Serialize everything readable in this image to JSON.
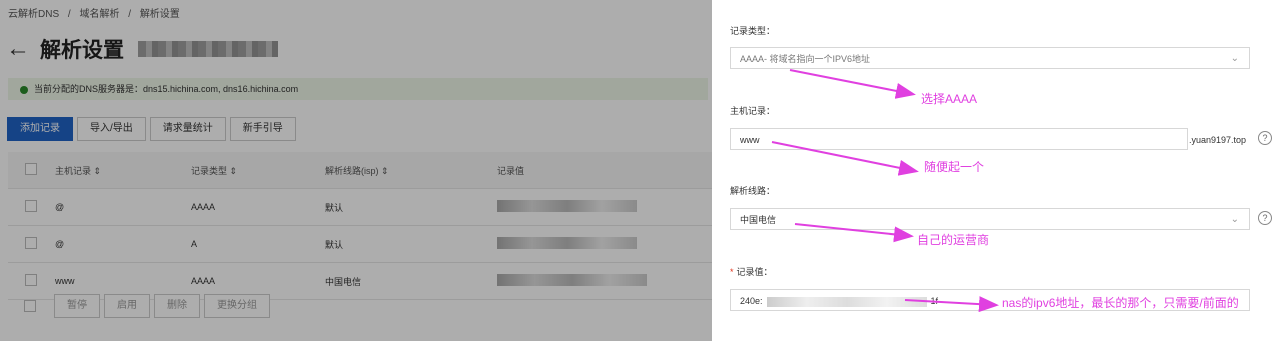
{
  "breadcrumb": [
    "云解析DNS",
    "/",
    "域名解析",
    "/",
    "解析设置"
  ],
  "page_title": "解析设置",
  "notice": "当前分配的DNS服务器是：dns15.hichina.com, dns16.hichina.com",
  "toolbar": [
    "添加记录",
    "导入/导出",
    "请求量统计",
    "新手引导"
  ],
  "table": {
    "headers": [
      "主机记录 ⇕",
      "记录类型 ⇕",
      "解析线路(isp) ⇕",
      "记录值"
    ],
    "rows": [
      {
        "host": "@",
        "type": "AAAA",
        "line": "默认"
      },
      {
        "host": "@",
        "type": "A",
        "line": "默认"
      },
      {
        "host": "www",
        "type": "AAAA",
        "line": "中国电信"
      }
    ]
  },
  "bulk_actions": [
    "暂停",
    "启用",
    "删除",
    "更换分组"
  ],
  "drawer": {
    "record_type_label": "记录类型：",
    "record_type_value": "AAAA- 将域名指向一个IPV6地址",
    "host_label": "主机记录：",
    "host_value": "www",
    "host_suffix": ".yuan9197.top",
    "line_label": "解析线路：",
    "line_value": "中国电信",
    "value_label": "记录值：",
    "value_prefix": "240e:",
    "value_suffix": "1f",
    "help_glyph": "?"
  },
  "annotations": {
    "type": "选择AAAA",
    "host": "随便起一个",
    "line": "自己的运营商",
    "value": "nas的ipv6地址，最长的那个，只需要/前面的"
  },
  "colors": {
    "primary": "#1f63c6",
    "annotation": "#e040e0",
    "required": "#e0331b"
  }
}
